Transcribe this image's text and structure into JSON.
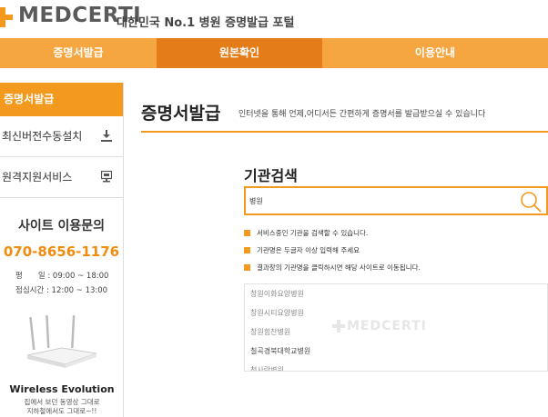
{
  "header": {
    "logo_text": "MEDCERTI",
    "tagline": "대한민국 No.1 병원 증명발급 포털"
  },
  "nav": {
    "items": [
      {
        "label": "증명서발급"
      },
      {
        "label": "원본확인"
      },
      {
        "label": "이용안내"
      }
    ]
  },
  "sidebar": {
    "active": "증명서발급",
    "items": [
      {
        "label": "최신버전수동설치",
        "icon": "download-icon"
      },
      {
        "label": "원격지원서비스",
        "icon": "monitor-icon"
      }
    ],
    "contact": {
      "title": "사이트 이용문의",
      "phone": "070-8656-1176",
      "hours_weekday": "평　　일 : 09:00 ~ 18:00",
      "hours_lunch": "점심시간 : 12:00 ~ 13:00"
    },
    "ad": {
      "title": "Wireless Evolution",
      "line1": "집에서 보던 동영상 그대로",
      "line2": "지하철에서도 그대로~!!"
    }
  },
  "main": {
    "title": "증명서발급",
    "description": "인터넷을 통해 언제,어디서든 간편하게 증명서를 발급받으실 수 있습니다"
  },
  "search": {
    "title": "기관검색",
    "value": "병원",
    "notes": [
      "서비스중인 기관을 검색할 수 있습니다.",
      "기관명은 두글자 이상 입력해 주세요",
      "결과창의 기관명을 클릭하시면 해당 사이트로 이동됩니다."
    ],
    "results": [
      "창원이화요양병원",
      "창원시티요양병원",
      "창원힘찬병원",
      "칠곡경북대학교병원",
      "척사랑병원"
    ],
    "watermark": "MEDCERTI"
  },
  "colors": {
    "accent": "#f39a1e",
    "nav_active": "#e47c18",
    "phone": "#f08c10"
  }
}
